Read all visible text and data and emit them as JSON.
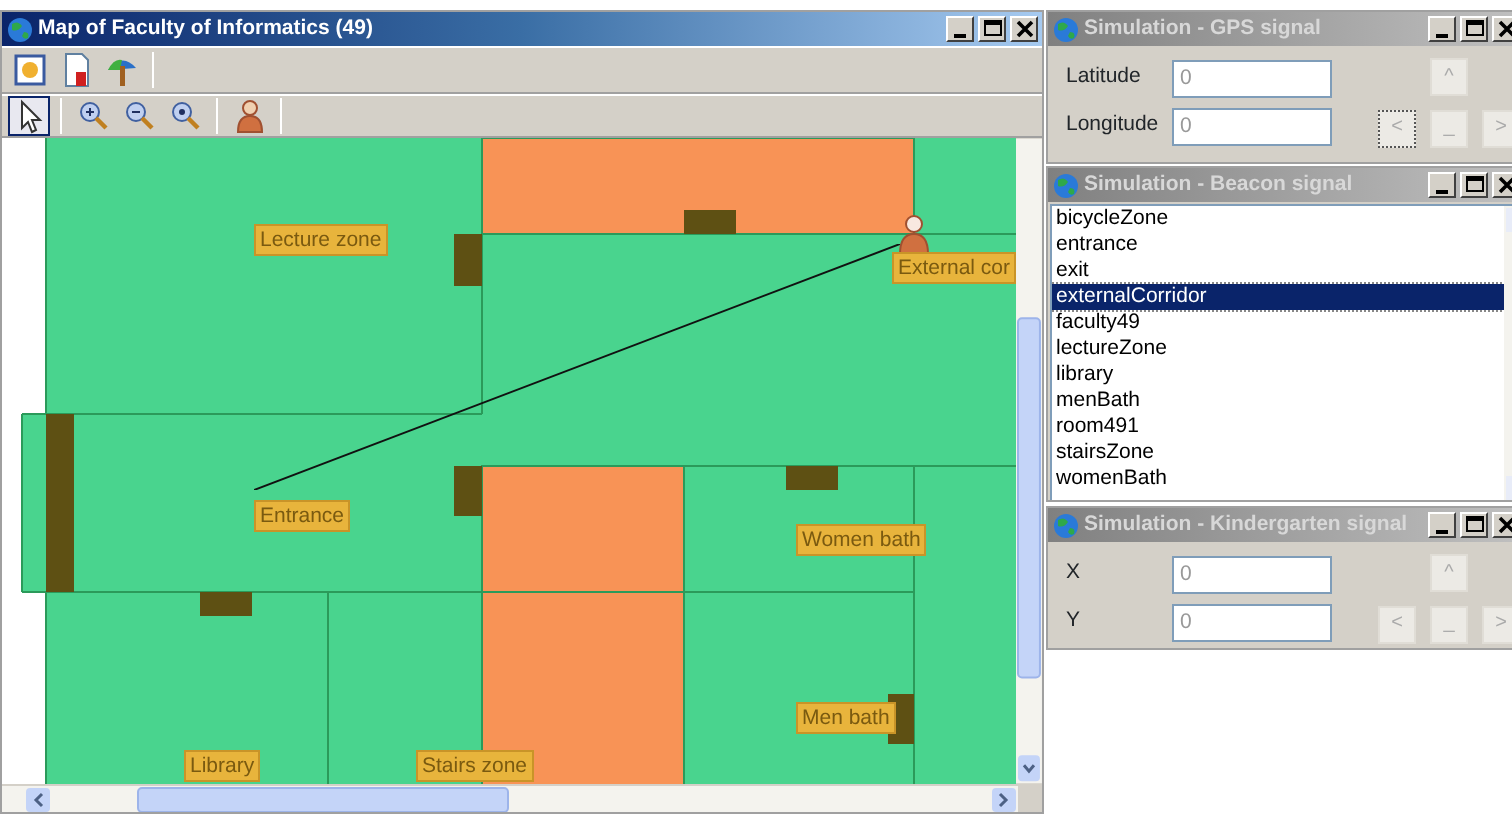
{
  "map_window": {
    "title": "Map of Faculty of Informatics (49)",
    "active": true,
    "tools": [
      {
        "kind": "pointer",
        "selected": true
      },
      {
        "kind": "zoom-in",
        "selected": false
      },
      {
        "kind": "zoom-out",
        "selected": false
      },
      {
        "kind": "zoom-reset",
        "selected": false
      },
      {
        "kind": "person",
        "selected": false
      }
    ],
    "map": {
      "labels": [
        "Lecture zone",
        "External cor",
        "Entrance",
        "Women bath",
        "Men bath",
        "Library",
        "Stairs zone"
      ]
    }
  },
  "gps_window": {
    "title": "Simulation - GPS signal",
    "active": false,
    "fields": [
      {
        "label": "Latitude",
        "value": "0"
      },
      {
        "label": "Longitude",
        "value": "0"
      }
    ],
    "buttons": [
      {
        "label": "^",
        "focused": false
      },
      {
        "label": "<",
        "focused": true
      },
      {
        "label": "_",
        "focused": false
      },
      {
        "label": ">",
        "focused": false
      }
    ]
  },
  "beacon_window": {
    "title": "Simulation - Beacon signal",
    "active": false,
    "items": [
      {
        "label": "bicycleZone",
        "selected": false
      },
      {
        "label": "entrance",
        "selected": false
      },
      {
        "label": "exit",
        "selected": false
      },
      {
        "label": "externalCorridor",
        "selected": true
      },
      {
        "label": "faculty49",
        "selected": false
      },
      {
        "label": "lectureZone",
        "selected": false
      },
      {
        "label": "library",
        "selected": false
      },
      {
        "label": "menBath",
        "selected": false
      },
      {
        "label": "room491",
        "selected": false
      },
      {
        "label": "stairsZone",
        "selected": false
      },
      {
        "label": "womenBath",
        "selected": false
      }
    ]
  },
  "kindergarten_window": {
    "title": "Simulation - Kindergarten signal",
    "active": false,
    "fields": [
      {
        "label": "X",
        "value": "0"
      },
      {
        "label": "Y",
        "value": "0"
      }
    ],
    "buttons": [
      {
        "label": "^",
        "focused": false
      },
      {
        "label": "<",
        "focused": false
      },
      {
        "label": "_",
        "focused": false
      },
      {
        "label": ">",
        "focused": false
      }
    ]
  }
}
